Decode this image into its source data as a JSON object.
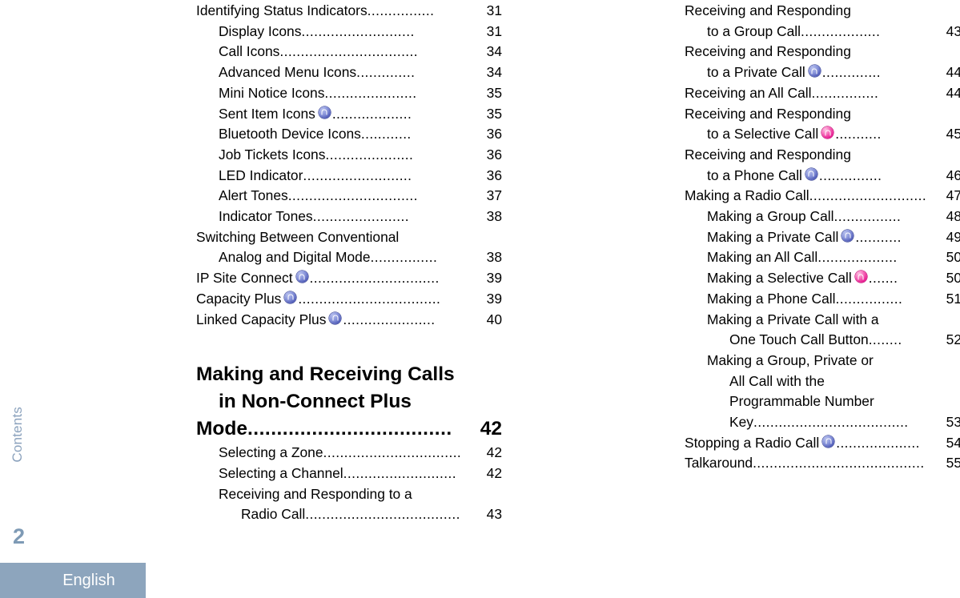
{
  "sidebar": {
    "tab_label": "Contents",
    "page_number": "2",
    "language_label": "English",
    "tab_color": "#8ba2bd",
    "bar_color": "#8da5bd"
  },
  "icons": {
    "blue": {
      "name": "ip-site-connect-icon",
      "color": "#4b57b4"
    },
    "pink": {
      "name": "capacity-plus-selective-icon",
      "color": "#e6128c"
    }
  },
  "toc": {
    "left_column": [
      {
        "level": 1,
        "label": "Identifying Status Indicators",
        "page": "31",
        "icon": null,
        "leader": "................"
      },
      {
        "level": 2,
        "label": "Display Icons",
        "page": "31",
        "icon": null,
        "leader": "..........................."
      },
      {
        "level": 2,
        "label": "Call Icons",
        "page": "34",
        "icon": null,
        "leader": "................................."
      },
      {
        "level": 2,
        "label": "Advanced Menu Icons",
        "page": "34",
        "icon": null,
        "leader": ".............."
      },
      {
        "level": 2,
        "label": "Mini Notice Icons",
        "page": "35",
        "icon": null,
        "leader": "......................"
      },
      {
        "level": 2,
        "label": "Sent Item Icons",
        "page": "35",
        "icon": "blue",
        "leader": "..................."
      },
      {
        "level": 2,
        "label": "Bluetooth Device Icons",
        "page": "36",
        "icon": null,
        "leader": "............"
      },
      {
        "level": 2,
        "label": "Job Tickets Icons",
        "page": "36",
        "icon": null,
        "leader": "....................."
      },
      {
        "level": 2,
        "label": "LED Indicator",
        "page": "36",
        "icon": null,
        "leader": ".........................."
      },
      {
        "level": 2,
        "label": "Alert Tones",
        "page": "37",
        "icon": null,
        "leader": "..............................."
      },
      {
        "level": 2,
        "label": "Indicator Tones",
        "page": "38",
        "icon": null,
        "leader": "......................."
      },
      {
        "level": 1,
        "label": "Switching Between Conventional",
        "page": "",
        "icon": null,
        "leader": "",
        "continues": true
      },
      {
        "level": 2,
        "label": "Analog and Digital Mode",
        "page": "38",
        "icon": null,
        "leader": "................"
      },
      {
        "level": 1,
        "label": "IP Site Connect",
        "page": "39",
        "icon": "blue",
        "leader": "..............................."
      },
      {
        "level": 1,
        "label": "Capacity Plus",
        "page": "39",
        "icon": "blue",
        "leader": ".................................."
      },
      {
        "level": 1,
        "label": "Linked Capacity Plus",
        "page": "40",
        "icon": "blue",
        "leader": "......................"
      }
    ],
    "left_heading": {
      "lines": [
        "Making and Receiving Calls",
        "in Non-Connect Plus"
      ],
      "last_line": "Mode",
      "leader": "...................................",
      "page": "42"
    },
    "left_after_heading": [
      {
        "level": 2,
        "label": "Selecting a Zone",
        "page": "42",
        "icon": null,
        "leader": "................................."
      },
      {
        "level": 2,
        "label": "Selecting a Channel",
        "page": "42",
        "icon": null,
        "leader": "..........................."
      },
      {
        "level": 2,
        "label": "Receiving and Responding to a",
        "page": "",
        "icon": null,
        "leader": "",
        "continues": true
      },
      {
        "level": 3,
        "label": "Radio Call",
        "page": "43",
        "icon": null,
        "leader": "....................................."
      }
    ],
    "right_column": [
      {
        "level": 1,
        "label": "Receiving and Responding",
        "page": "",
        "icon": null,
        "leader": "",
        "continues": true
      },
      {
        "level": 2,
        "label": "to a Group Call",
        "page": "43",
        "icon": null,
        "leader": "..................."
      },
      {
        "level": 1,
        "label": "Receiving and Responding",
        "page": "",
        "icon": null,
        "leader": "",
        "continues": true
      },
      {
        "level": 2,
        "label": "to a Private Call",
        "page": "44",
        "icon": "blue",
        "leader": ".............."
      },
      {
        "level": 1,
        "label": "Receiving an All Call",
        "page": "44",
        "icon": null,
        "leader": "................"
      },
      {
        "level": 1,
        "label": "Receiving and Responding",
        "page": "",
        "icon": null,
        "leader": "",
        "continues": true
      },
      {
        "level": 2,
        "label": "to a Selective Call",
        "page": "45",
        "icon": "pink",
        "leader": "..........."
      },
      {
        "level": 1,
        "label": "Receiving and Responding",
        "page": "",
        "icon": null,
        "leader": "",
        "continues": true
      },
      {
        "level": 2,
        "label": "to a Phone Call",
        "page": "46",
        "icon": "blue",
        "leader": "..............."
      },
      {
        "level": 1,
        "label": "Making a Radio Call",
        "page": "47",
        "icon": null,
        "leader": "............................"
      },
      {
        "level": 2,
        "label": "Making a Group Call",
        "page": "48",
        "icon": null,
        "leader": "................"
      },
      {
        "level": 2,
        "label": "Making a Private Call",
        "page": "49",
        "icon": "blue",
        "leader": "..........."
      },
      {
        "level": 2,
        "label": "Making an All Call",
        "page": "50",
        "icon": null,
        "leader": "..................."
      },
      {
        "level": 2,
        "label": "Making a Selective Call",
        "page": "50",
        "icon": "pink",
        "leader": "......."
      },
      {
        "level": 2,
        "label": "Making a Phone Call",
        "page": "51",
        "icon": null,
        "leader": "................"
      },
      {
        "level": 2,
        "label": "Making a Private Call with a",
        "page": "",
        "icon": null,
        "leader": "",
        "continues": true
      },
      {
        "level": 3,
        "label": "One Touch Call Button",
        "page": "52",
        "icon": null,
        "leader": "........"
      },
      {
        "level": 2,
        "label": "Making a Group, Private or",
        "page": "",
        "icon": null,
        "leader": "",
        "continues": true
      },
      {
        "level": 3,
        "label": "All Call with the",
        "page": "",
        "icon": null,
        "leader": "",
        "continues": true
      },
      {
        "level": 3,
        "label": "Programmable Number",
        "page": "",
        "icon": null,
        "leader": "",
        "continues": true
      },
      {
        "level": 3,
        "label": "Key ",
        "page": "53",
        "icon": null,
        "leader": "....................................."
      },
      {
        "level": 1,
        "label": "Stopping a Radio Call",
        "page": "54",
        "icon": "blue",
        "leader": "...................."
      },
      {
        "level": 1,
        "label": "Talkaround",
        "page": "55",
        "icon": null,
        "leader": "........................................."
      }
    ]
  }
}
